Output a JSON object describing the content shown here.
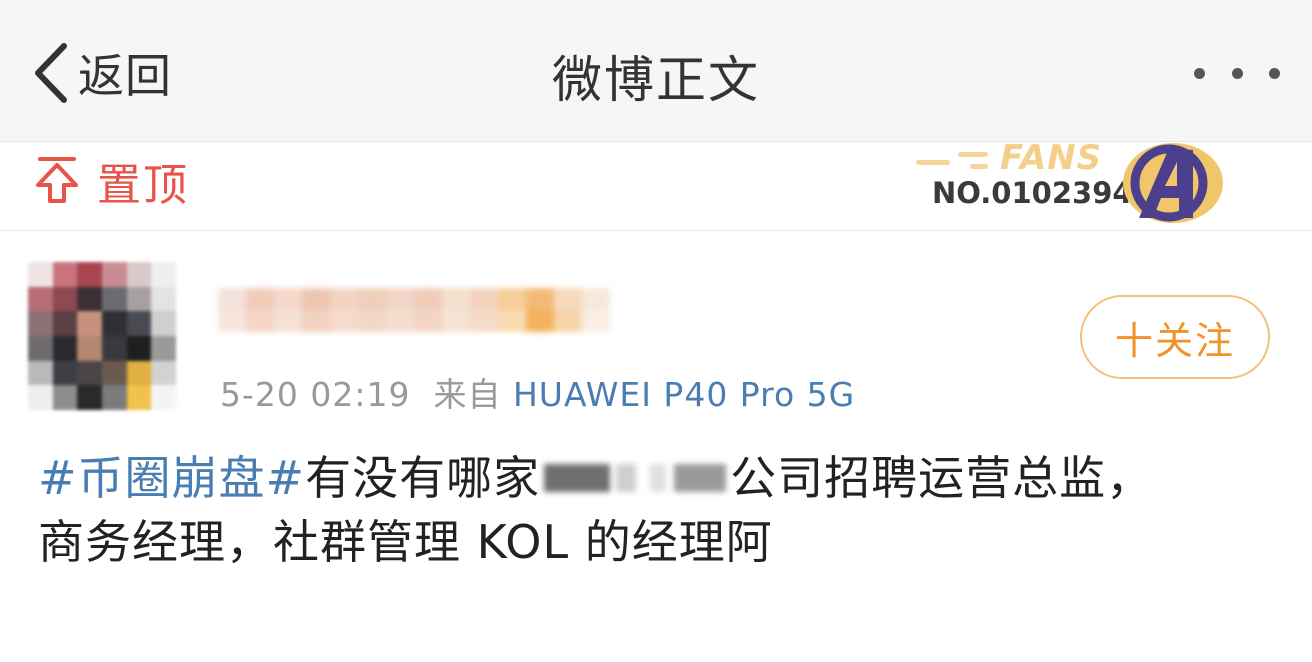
{
  "navbar": {
    "back_label": "返回",
    "title": "微博正文",
    "icons": {
      "back": "chevron-left-icon",
      "more": "more-dots-icon"
    }
  },
  "pinned": {
    "label": "置顶",
    "icon": "pin-top-icon",
    "color": "#e8534a"
  },
  "fans_badge": {
    "fans_text": "FANS",
    "number": "NO.0102394",
    "emblem": "avengers-a-icon"
  },
  "post": {
    "avatar": "blurred-avatar",
    "username": "",
    "timestamp": "5-20 02:19",
    "source_prefix": "来自",
    "device": "HUAWEI P40 Pro 5G",
    "follow_label": "十关注",
    "topic": "#币圈崩盘#",
    "text_before_blur": "有没有哪家",
    "text_after_blur": "公司招聘运营总监，",
    "text_line2": "商务经理，社群管理 KOL 的经理阿"
  },
  "colors": {
    "link_blue": "#4a7eb3",
    "follow_orange": "#f2922a",
    "follow_border": "#f2c27a",
    "navbar_bg": "#f6f6f6"
  }
}
